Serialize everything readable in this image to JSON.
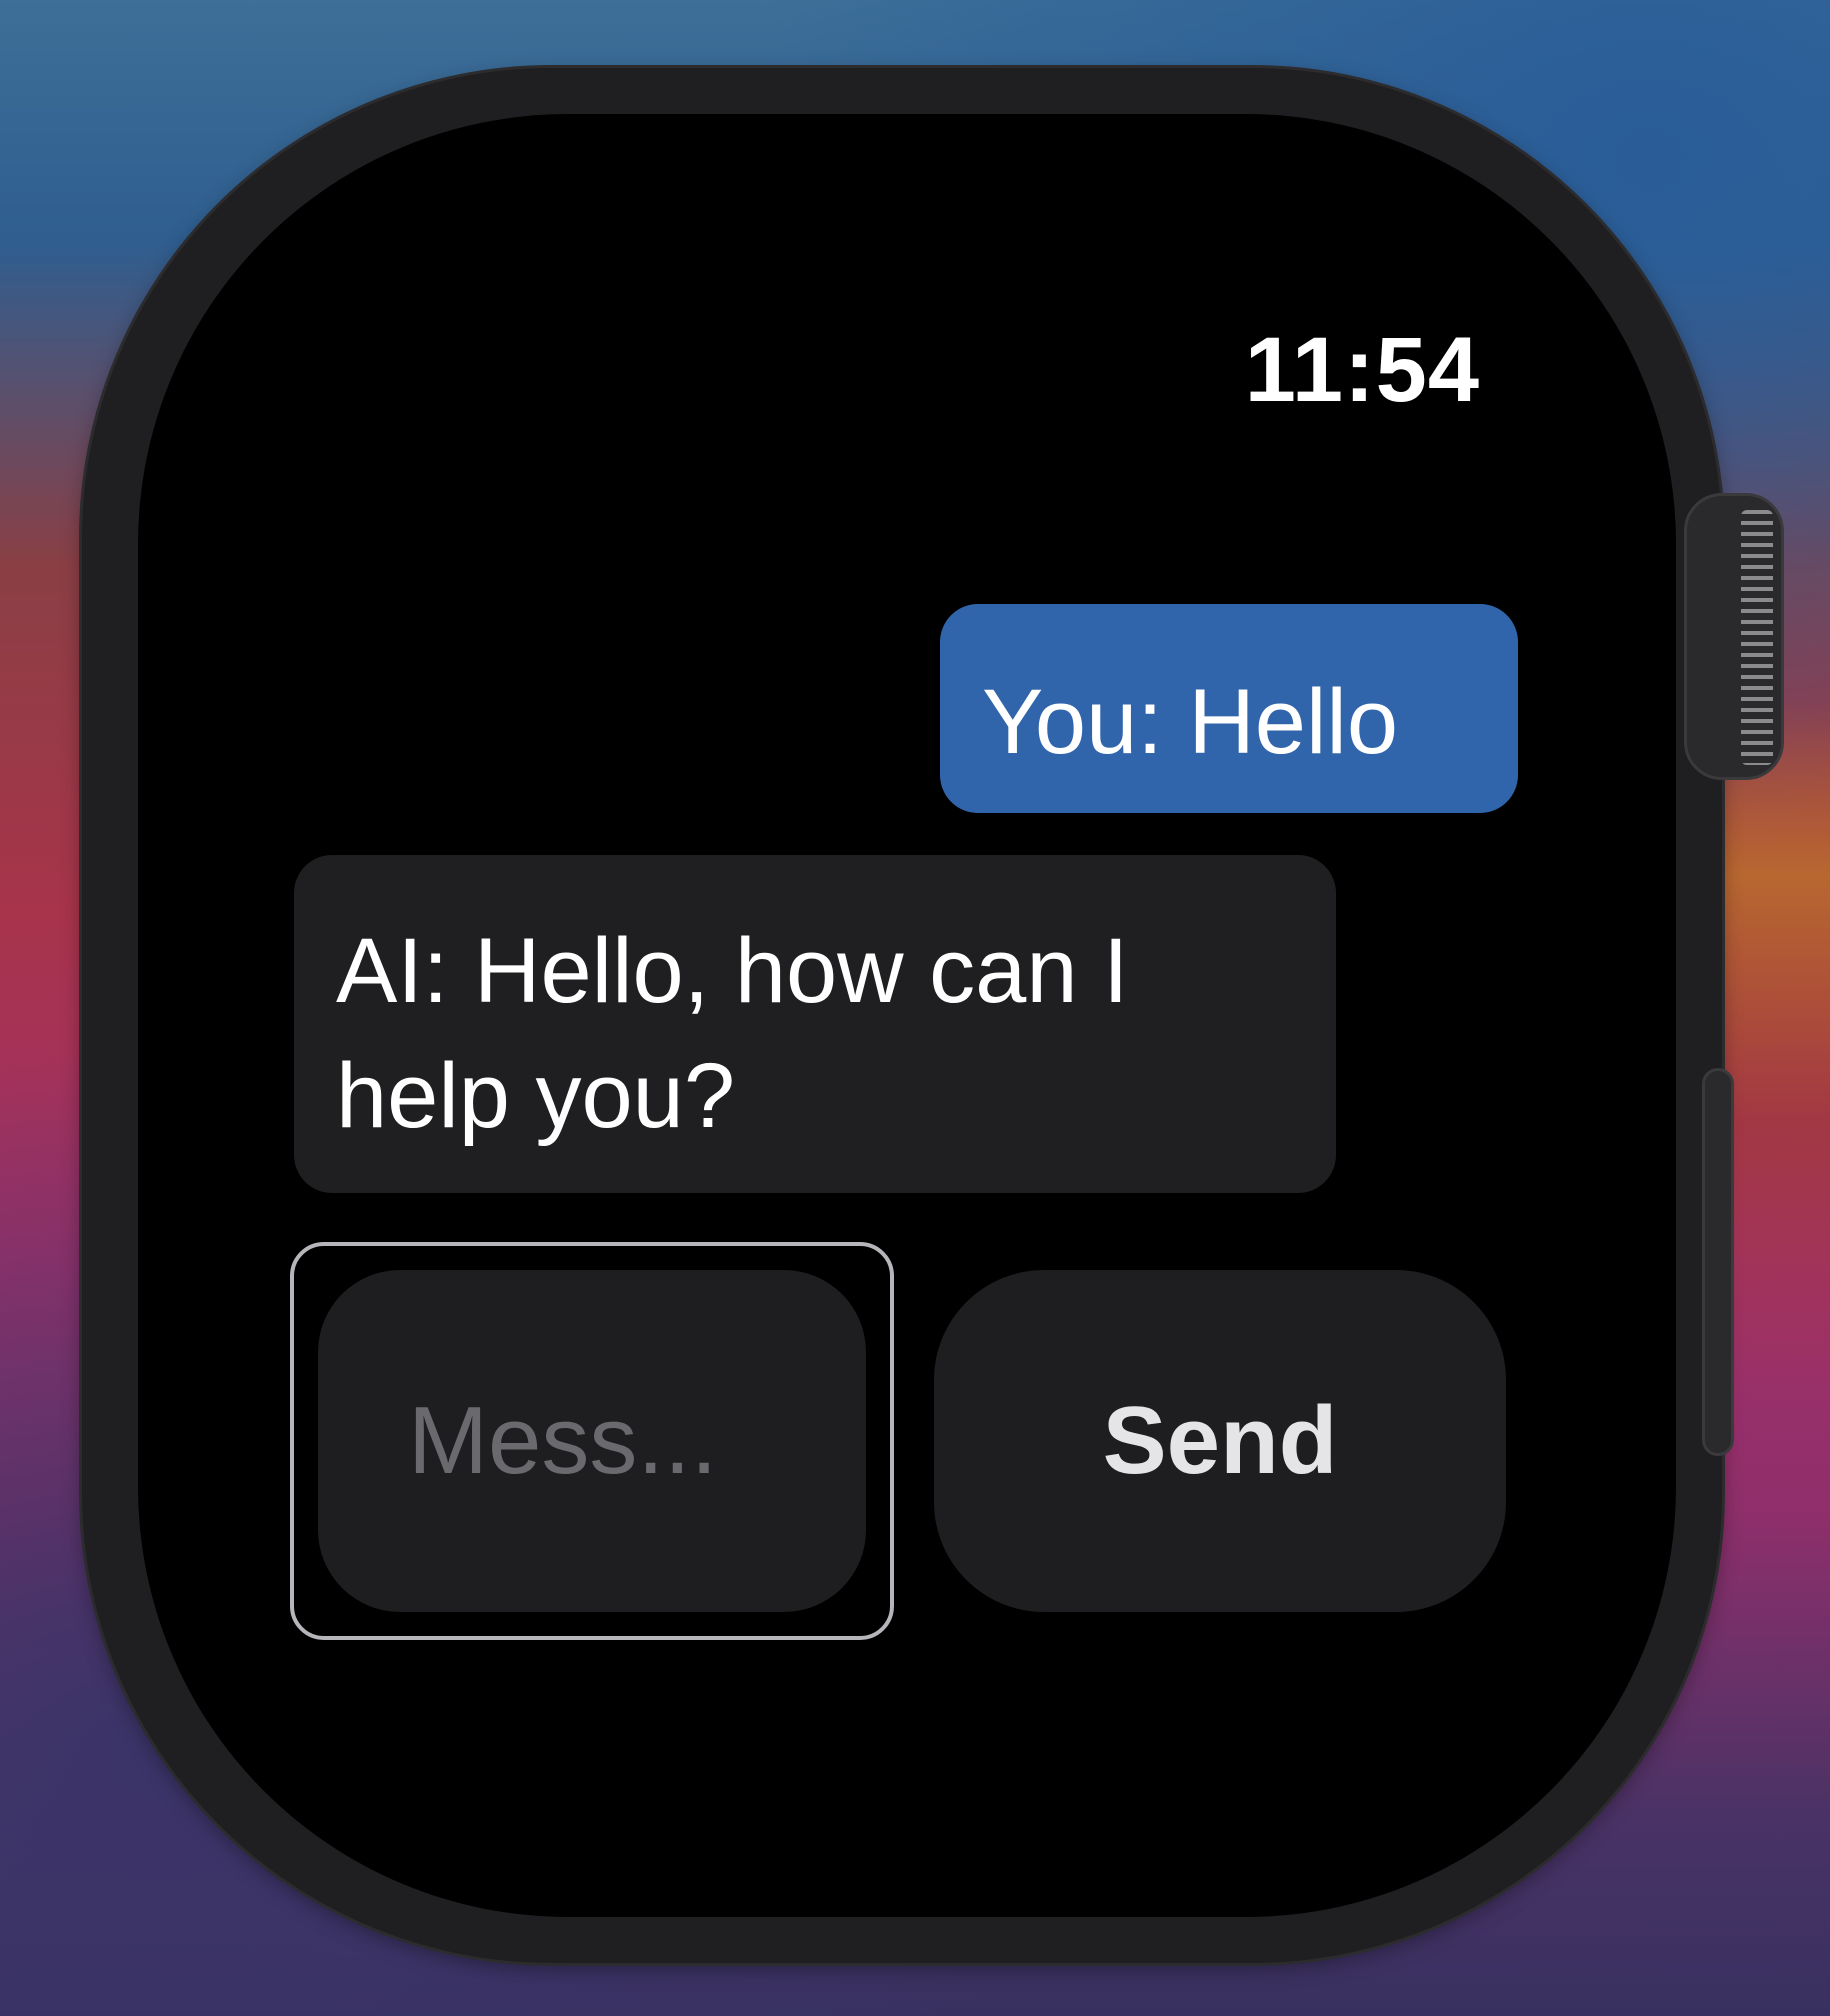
{
  "status_bar": {
    "time": "11:54"
  },
  "conversation": {
    "messages": [
      {
        "sender": "user",
        "text": "You: Hello"
      },
      {
        "sender": "ai",
        "text": "AI: Hello, how can I help you?"
      }
    ]
  },
  "composer": {
    "input_placeholder": "Mess...",
    "send_label": "Send"
  },
  "colors": {
    "user_bubble": "#3165ab",
    "ai_bubble": "#1f1f21",
    "screen_background": "#000000"
  }
}
